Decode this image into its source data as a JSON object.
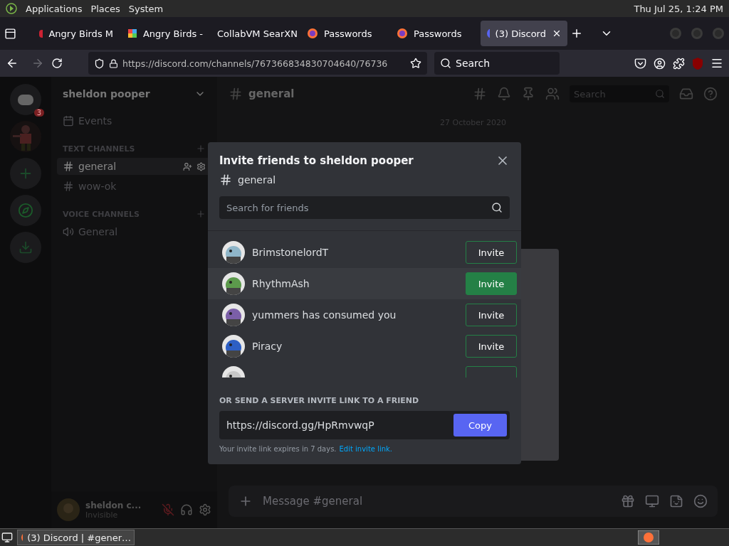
{
  "top_panel": {
    "menus": [
      "Applications",
      "Places",
      "System"
    ],
    "clock": "Thu Jul 25, 1:24 PM"
  },
  "browser": {
    "tabs": [
      {
        "label": "Angry Birds M",
        "selected": false
      },
      {
        "label": "Angry Birds -",
        "selected": false
      },
      {
        "label": "CollabVM SearXN",
        "selected": false
      },
      {
        "label": "Passwords",
        "selected": false
      },
      {
        "label": "Passwords",
        "selected": false
      },
      {
        "label": "(3) Discord",
        "selected": true
      }
    ],
    "url": "https://discord.com/channels/767366834830704640/76736",
    "search_placeholder": "Search",
    "forward_disabled": true
  },
  "discord": {
    "servers": [
      {
        "kind": "home",
        "badge": "3"
      },
      {
        "kind": "server"
      },
      {
        "kind": "add"
      },
      {
        "kind": "explore"
      },
      {
        "kind": "download"
      }
    ],
    "server_name": "sheldon pooper",
    "events": "Events",
    "categories": [
      {
        "name": "TEXT CHANNELS",
        "channels": [
          {
            "name": "general",
            "kind": "text",
            "selected": true
          },
          {
            "name": "wow-ok",
            "kind": "text",
            "selected": false
          }
        ]
      },
      {
        "name": "VOICE CHANNELS",
        "channels": [
          {
            "name": "General",
            "kind": "voice",
            "selected": false
          }
        ]
      }
    ],
    "user": {
      "name": "sheldon c...",
      "status": "Invisible"
    },
    "channel_header": "general",
    "header_search": "Search",
    "date_divider": "27 October 2020",
    "message_placeholder": "Message #general"
  },
  "invite_modal": {
    "title": "Invite friends to sheldon pooper",
    "channel": "general",
    "search_placeholder": "Search for friends",
    "friends": [
      {
        "kind": "full",
        "name": "BrimstonelordT",
        "button": "Invite",
        "hovered": false,
        "color": "#8fb6c9"
      },
      {
        "kind": "full",
        "name": "RhythmAsh",
        "button": "Invite",
        "hovered": true,
        "color": "#5c9a4c"
      },
      {
        "kind": "full",
        "name": "yummers has consumed you",
        "button": "Invite",
        "hovered": false,
        "color": "#7b5fa8"
      },
      {
        "kind": "full",
        "name": "Piracy",
        "button": "Invite",
        "hovered": false,
        "color": "#2d5fc4"
      },
      {
        "kind": "partial",
        "hovered": false,
        "color": "#c8c8c8"
      }
    ],
    "link_heading": "OR SEND A SERVER INVITE LINK TO A FRIEND",
    "link": "https://discord.gg/HpRmvwqP",
    "copy": "Copy",
    "expiry_note": "Your invite link expires in 7 days.",
    "edit_link": "Edit invite link."
  },
  "taskbar": {
    "task": "(3) Discord | #gener…"
  }
}
